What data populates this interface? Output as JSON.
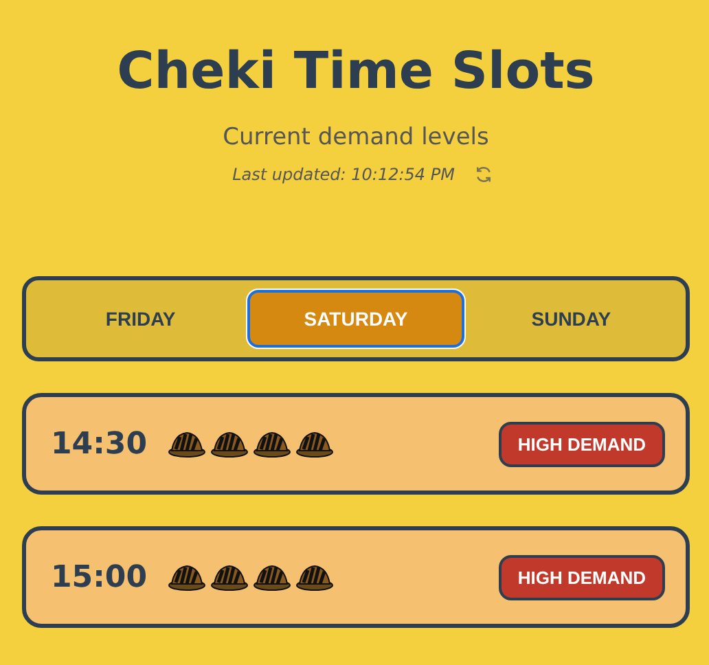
{
  "header": {
    "title": "Cheki Time Slots",
    "subtitle": "Current demand levels",
    "last_updated": "Last updated: 10:12:54 PM"
  },
  "tabs": [
    {
      "label": "FRIDAY",
      "selected": false
    },
    {
      "label": "SATURDAY",
      "selected": true
    },
    {
      "label": "SUNDAY",
      "selected": false
    }
  ],
  "slots": [
    {
      "time": "14:30",
      "demand_icons": [
        {
          "kind": "cake"
        },
        {
          "kind": "cake"
        },
        {
          "kind": "cake"
        },
        {
          "kind": "cake"
        }
      ],
      "badge": "HIGH DEMAND"
    },
    {
      "time": "15:00",
      "demand_icons": [
        {
          "kind": "cake"
        },
        {
          "kind": "cake"
        },
        {
          "kind": "cake"
        },
        {
          "kind": "cake"
        }
      ],
      "badge": "HIGH DEMAND"
    }
  ]
}
